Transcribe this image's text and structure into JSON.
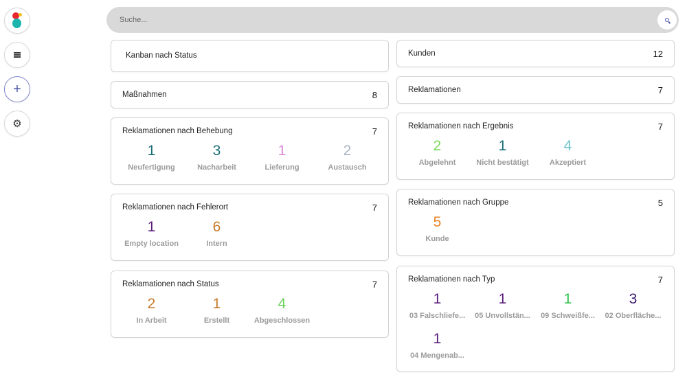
{
  "search": {
    "placeholder": "Suche..."
  },
  "sidebar": {
    "icons": [
      "app-logo",
      "menu-icon",
      "plus-icon",
      "gear-icon"
    ]
  },
  "cards": {
    "kanban": {
      "title": "Kanban nach Status"
    },
    "massnahmen": {
      "title": "Maßnahmen",
      "count": "8"
    },
    "behebung": {
      "title": "Reklamationen nach Behebung",
      "count": "7",
      "stats": [
        {
          "value": "1",
          "label": "Neufertigung",
          "color": "#1a6e78"
        },
        {
          "value": "3",
          "label": "Nacharbeit",
          "color": "#1a6e78"
        },
        {
          "value": "1",
          "label": "Lieferung",
          "color": "#d98ad9"
        },
        {
          "value": "2",
          "label": "Austausch",
          "color": "#a9b3c4"
        }
      ]
    },
    "fehlerort": {
      "title": "Reklamationen nach Fehlerort",
      "count": "7",
      "stats": [
        {
          "value": "1",
          "label": "Empty location",
          "color": "#5a1d7a"
        },
        {
          "value": "6",
          "label": "Intern",
          "color": "#c77a2a"
        }
      ]
    },
    "status": {
      "title": "Reklamationen nach Status",
      "count": "7",
      "stats": [
        {
          "value": "2",
          "label": "In Arbeit",
          "color": "#c77a2a"
        },
        {
          "value": "1",
          "label": "Erstellt",
          "color": "#c77a2a"
        },
        {
          "value": "4",
          "label": "Abgeschlossen",
          "color": "#6ad05a"
        }
      ]
    },
    "kunden": {
      "title": "Kunden",
      "count": "12"
    },
    "reklamationen": {
      "title": "Reklamationen",
      "count": "7"
    },
    "ergebnis": {
      "title": "Reklamationen nach Ergebnis",
      "count": "7",
      "stats": [
        {
          "value": "2",
          "label": "Abgelehnt",
          "color": "#7cd95a"
        },
        {
          "value": "1",
          "label": "Nicht bestätigt",
          "color": "#1a6e78"
        },
        {
          "value": "4",
          "label": "Akzeptiert",
          "color": "#6cc3c9"
        }
      ]
    },
    "gruppe": {
      "title": "Reklamationen nach Gruppe",
      "count": "5",
      "stats": [
        {
          "value": "5",
          "label": "Kunde",
          "color": "#e8842a"
        }
      ]
    },
    "typ": {
      "title": "Reklamationen nach Typ",
      "count": "7",
      "stats": [
        {
          "value": "1",
          "label": "03 Falschliefe...",
          "color": "#5a1d7a"
        },
        {
          "value": "1",
          "label": "05 Unvollstän...",
          "color": "#5a1d7a"
        },
        {
          "value": "1",
          "label": "09 Schweißfe...",
          "color": "#2fc24a"
        },
        {
          "value": "3",
          "label": "02 Oberfläche...",
          "color": "#3a1a6e"
        },
        {
          "value": "1",
          "label": "04 Mengenab...",
          "color": "#5a1d7a"
        }
      ]
    }
  }
}
